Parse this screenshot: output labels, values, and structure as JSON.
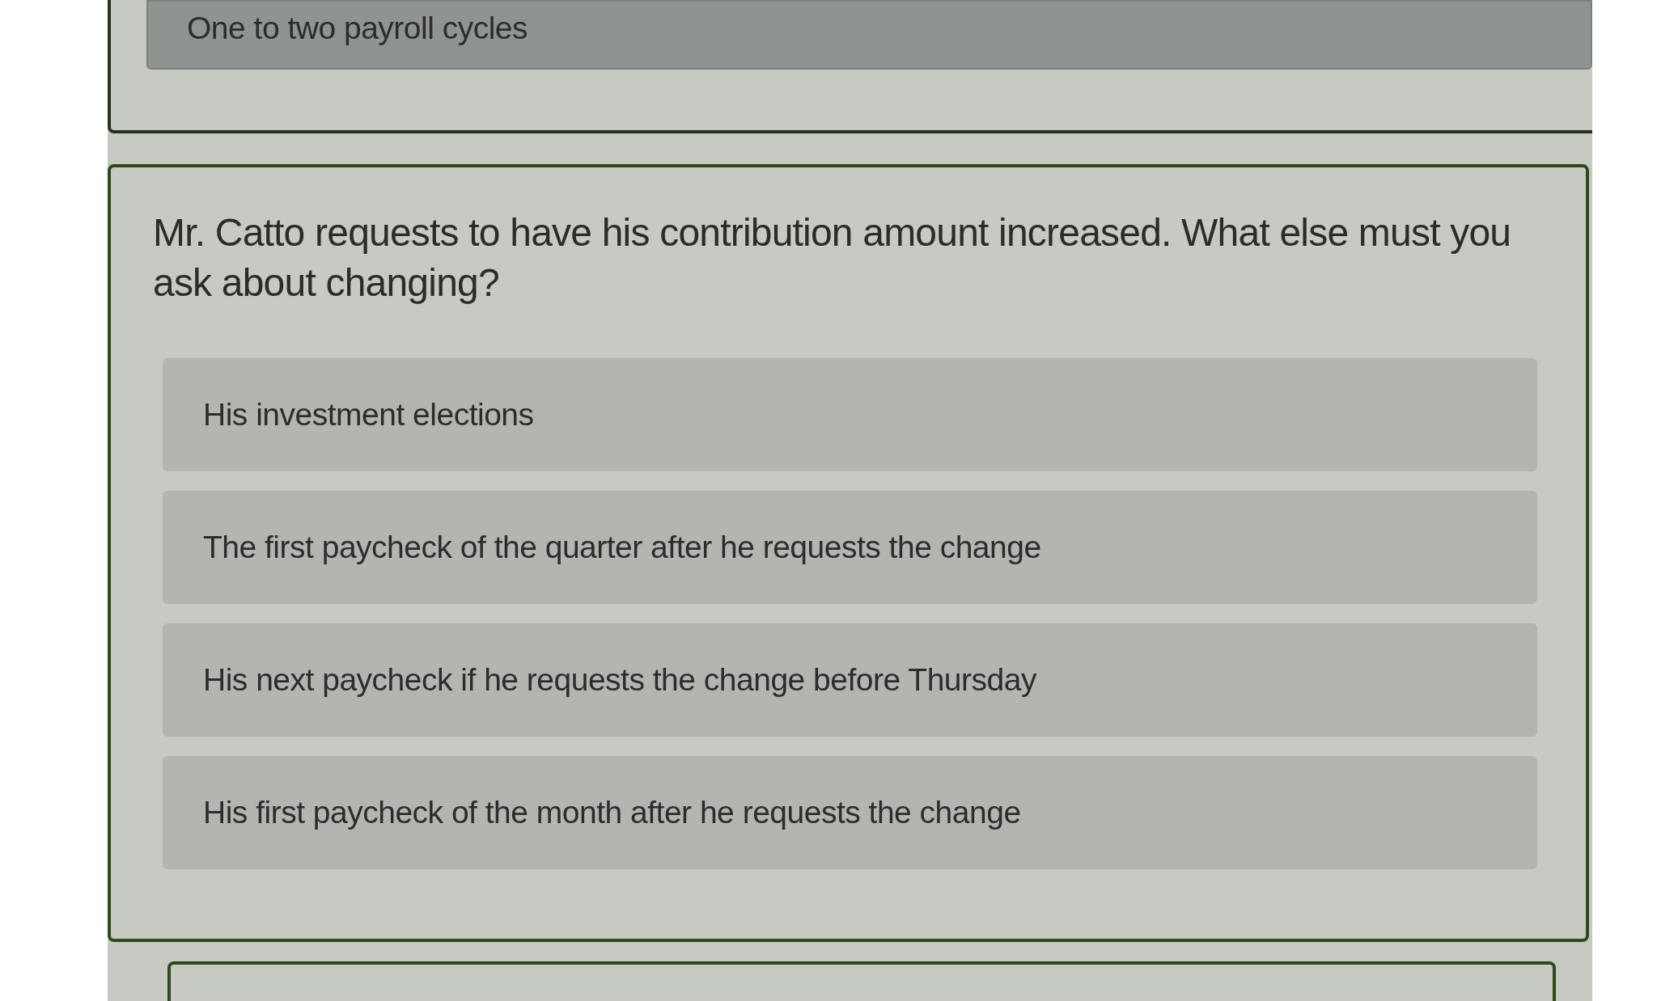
{
  "previous_question": {
    "options": [
      {
        "text": "One to two payroll cycles",
        "selected": true
      }
    ]
  },
  "question": {
    "prompt": "Mr. Catto requests to have his contribution amount increased. What else must you ask about changing?",
    "options": [
      {
        "text": "His investment elections",
        "selected": false
      },
      {
        "text": "The first paycheck of the quarter after he requests the change",
        "selected": false
      },
      {
        "text": "His next paycheck if he requests the change before Thursday",
        "selected": false
      },
      {
        "text": "His first paycheck of the month after he requests the change",
        "selected": false
      }
    ]
  }
}
